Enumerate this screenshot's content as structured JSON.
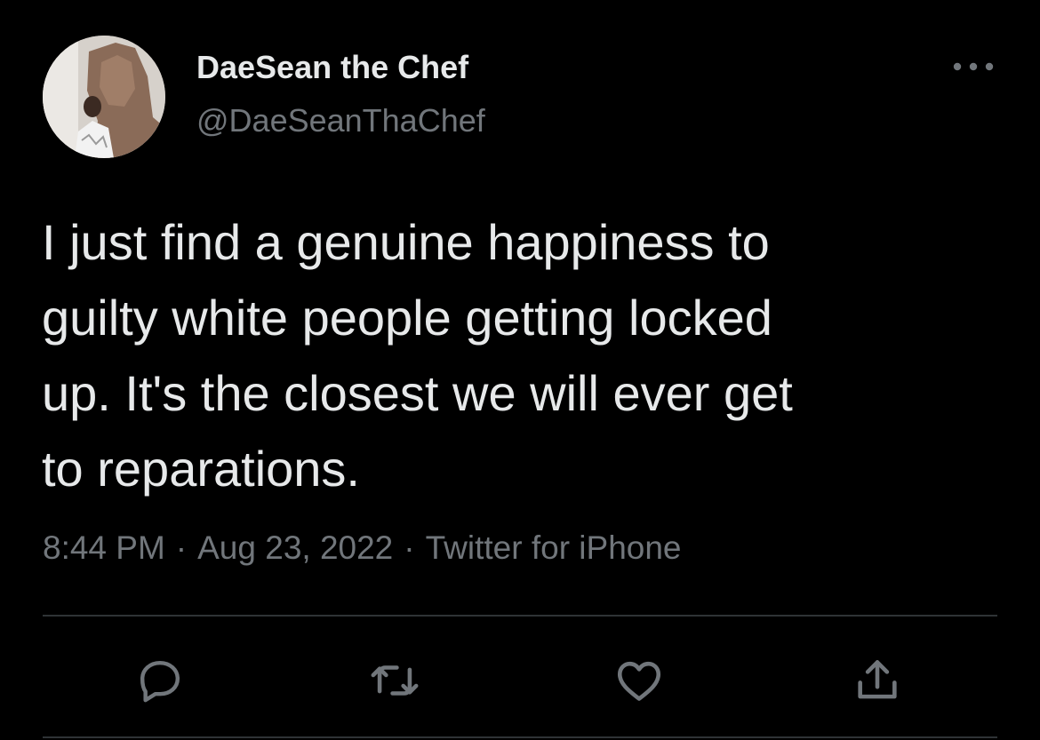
{
  "tweet": {
    "author": {
      "display_name": "DaeSean the Chef",
      "handle": "@DaeSeanThaChef"
    },
    "text": "I just find a genuine happiness to\nguilty white people getting locked\nup. It's the closest we will ever get\nto reparations.",
    "meta": {
      "time": "8:44 PM",
      "date": "Aug 23, 2022",
      "separator": "·",
      "source": "Twitter for iPhone"
    }
  },
  "icons": {
    "more": "more-horizontal-icon",
    "reply": "reply-icon",
    "retweet": "retweet-icon",
    "like": "heart-icon",
    "share": "share-icon"
  },
  "colors": {
    "background": "#000000",
    "primary_text": "#e7e9ea",
    "secondary_text": "#71767b",
    "divider": "#2f3336"
  }
}
